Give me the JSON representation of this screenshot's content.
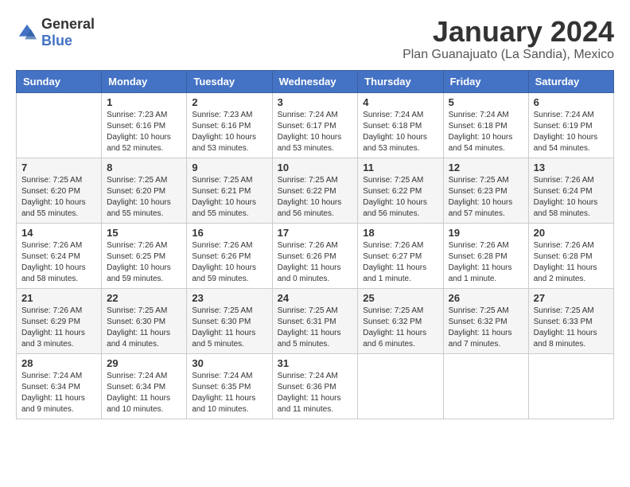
{
  "logo": {
    "general": "General",
    "blue": "Blue"
  },
  "title": "January 2024",
  "location": "Plan Guanajuato (La Sandia), Mexico",
  "days_of_week": [
    "Sunday",
    "Monday",
    "Tuesday",
    "Wednesday",
    "Thursday",
    "Friday",
    "Saturday"
  ],
  "weeks": [
    [
      {
        "day": "",
        "sunrise": "",
        "sunset": "",
        "daylight": ""
      },
      {
        "day": "1",
        "sunrise": "Sunrise: 7:23 AM",
        "sunset": "Sunset: 6:16 PM",
        "daylight": "Daylight: 10 hours and 52 minutes."
      },
      {
        "day": "2",
        "sunrise": "Sunrise: 7:23 AM",
        "sunset": "Sunset: 6:16 PM",
        "daylight": "Daylight: 10 hours and 53 minutes."
      },
      {
        "day": "3",
        "sunrise": "Sunrise: 7:24 AM",
        "sunset": "Sunset: 6:17 PM",
        "daylight": "Daylight: 10 hours and 53 minutes."
      },
      {
        "day": "4",
        "sunrise": "Sunrise: 7:24 AM",
        "sunset": "Sunset: 6:18 PM",
        "daylight": "Daylight: 10 hours and 53 minutes."
      },
      {
        "day": "5",
        "sunrise": "Sunrise: 7:24 AM",
        "sunset": "Sunset: 6:18 PM",
        "daylight": "Daylight: 10 hours and 54 minutes."
      },
      {
        "day": "6",
        "sunrise": "Sunrise: 7:24 AM",
        "sunset": "Sunset: 6:19 PM",
        "daylight": "Daylight: 10 hours and 54 minutes."
      }
    ],
    [
      {
        "day": "7",
        "sunrise": "Sunrise: 7:25 AM",
        "sunset": "Sunset: 6:20 PM",
        "daylight": "Daylight: 10 hours and 55 minutes."
      },
      {
        "day": "8",
        "sunrise": "Sunrise: 7:25 AM",
        "sunset": "Sunset: 6:20 PM",
        "daylight": "Daylight: 10 hours and 55 minutes."
      },
      {
        "day": "9",
        "sunrise": "Sunrise: 7:25 AM",
        "sunset": "Sunset: 6:21 PM",
        "daylight": "Daylight: 10 hours and 55 minutes."
      },
      {
        "day": "10",
        "sunrise": "Sunrise: 7:25 AM",
        "sunset": "Sunset: 6:22 PM",
        "daylight": "Daylight: 10 hours and 56 minutes."
      },
      {
        "day": "11",
        "sunrise": "Sunrise: 7:25 AM",
        "sunset": "Sunset: 6:22 PM",
        "daylight": "Daylight: 10 hours and 56 minutes."
      },
      {
        "day": "12",
        "sunrise": "Sunrise: 7:25 AM",
        "sunset": "Sunset: 6:23 PM",
        "daylight": "Daylight: 10 hours and 57 minutes."
      },
      {
        "day": "13",
        "sunrise": "Sunrise: 7:26 AM",
        "sunset": "Sunset: 6:24 PM",
        "daylight": "Daylight: 10 hours and 58 minutes."
      }
    ],
    [
      {
        "day": "14",
        "sunrise": "Sunrise: 7:26 AM",
        "sunset": "Sunset: 6:24 PM",
        "daylight": "Daylight: 10 hours and 58 minutes."
      },
      {
        "day": "15",
        "sunrise": "Sunrise: 7:26 AM",
        "sunset": "Sunset: 6:25 PM",
        "daylight": "Daylight: 10 hours and 59 minutes."
      },
      {
        "day": "16",
        "sunrise": "Sunrise: 7:26 AM",
        "sunset": "Sunset: 6:26 PM",
        "daylight": "Daylight: 10 hours and 59 minutes."
      },
      {
        "day": "17",
        "sunrise": "Sunrise: 7:26 AM",
        "sunset": "Sunset: 6:26 PM",
        "daylight": "Daylight: 11 hours and 0 minutes."
      },
      {
        "day": "18",
        "sunrise": "Sunrise: 7:26 AM",
        "sunset": "Sunset: 6:27 PM",
        "daylight": "Daylight: 11 hours and 1 minute."
      },
      {
        "day": "19",
        "sunrise": "Sunrise: 7:26 AM",
        "sunset": "Sunset: 6:28 PM",
        "daylight": "Daylight: 11 hours and 1 minute."
      },
      {
        "day": "20",
        "sunrise": "Sunrise: 7:26 AM",
        "sunset": "Sunset: 6:28 PM",
        "daylight": "Daylight: 11 hours and 2 minutes."
      }
    ],
    [
      {
        "day": "21",
        "sunrise": "Sunrise: 7:26 AM",
        "sunset": "Sunset: 6:29 PM",
        "daylight": "Daylight: 11 hours and 3 minutes."
      },
      {
        "day": "22",
        "sunrise": "Sunrise: 7:25 AM",
        "sunset": "Sunset: 6:30 PM",
        "daylight": "Daylight: 11 hours and 4 minutes."
      },
      {
        "day": "23",
        "sunrise": "Sunrise: 7:25 AM",
        "sunset": "Sunset: 6:30 PM",
        "daylight": "Daylight: 11 hours and 5 minutes."
      },
      {
        "day": "24",
        "sunrise": "Sunrise: 7:25 AM",
        "sunset": "Sunset: 6:31 PM",
        "daylight": "Daylight: 11 hours and 5 minutes."
      },
      {
        "day": "25",
        "sunrise": "Sunrise: 7:25 AM",
        "sunset": "Sunset: 6:32 PM",
        "daylight": "Daylight: 11 hours and 6 minutes."
      },
      {
        "day": "26",
        "sunrise": "Sunrise: 7:25 AM",
        "sunset": "Sunset: 6:32 PM",
        "daylight": "Daylight: 11 hours and 7 minutes."
      },
      {
        "day": "27",
        "sunrise": "Sunrise: 7:25 AM",
        "sunset": "Sunset: 6:33 PM",
        "daylight": "Daylight: 11 hours and 8 minutes."
      }
    ],
    [
      {
        "day": "28",
        "sunrise": "Sunrise: 7:24 AM",
        "sunset": "Sunset: 6:34 PM",
        "daylight": "Daylight: 11 hours and 9 minutes."
      },
      {
        "day": "29",
        "sunrise": "Sunrise: 7:24 AM",
        "sunset": "Sunset: 6:34 PM",
        "daylight": "Daylight: 11 hours and 10 minutes."
      },
      {
        "day": "30",
        "sunrise": "Sunrise: 7:24 AM",
        "sunset": "Sunset: 6:35 PM",
        "daylight": "Daylight: 11 hours and 10 minutes."
      },
      {
        "day": "31",
        "sunrise": "Sunrise: 7:24 AM",
        "sunset": "Sunset: 6:36 PM",
        "daylight": "Daylight: 11 hours and 11 minutes."
      },
      {
        "day": "",
        "sunrise": "",
        "sunset": "",
        "daylight": ""
      },
      {
        "day": "",
        "sunrise": "",
        "sunset": "",
        "daylight": ""
      },
      {
        "day": "",
        "sunrise": "",
        "sunset": "",
        "daylight": ""
      }
    ]
  ]
}
